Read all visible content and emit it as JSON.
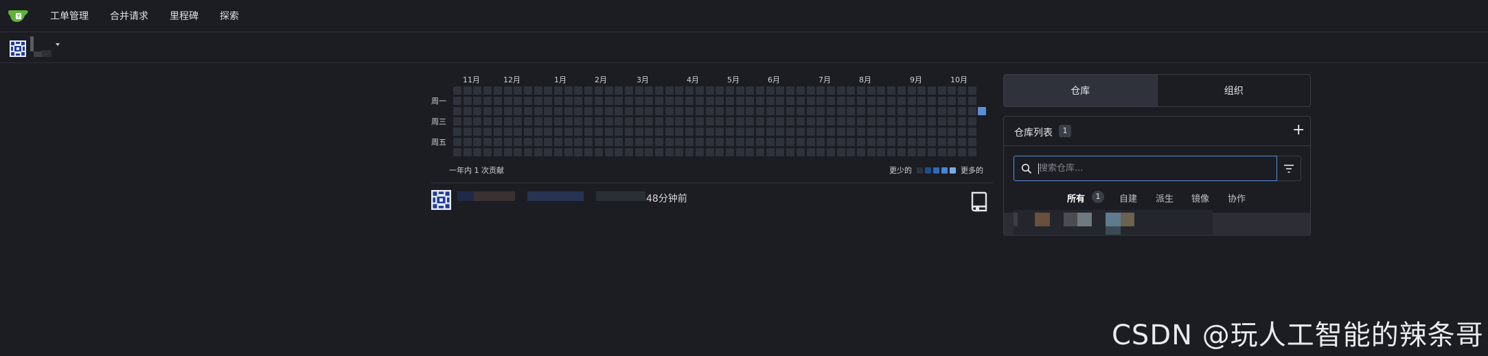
{
  "navbar": {
    "items": [
      "工单管理",
      "合并请求",
      "里程碑",
      "探索"
    ]
  },
  "heatmap": {
    "months": [
      "11月",
      "12月",
      "1月",
      "2月",
      "3月",
      "4月",
      "5月",
      "6月",
      "7月",
      "8月",
      "9月",
      "10月"
    ],
    "weekdays": [
      "周一",
      "周三",
      "周五"
    ],
    "summary": "一年内 1 次贡献",
    "legend_less": "更少的",
    "legend_more": "更多的",
    "legend_colors": [
      "#2e323b",
      "#1f4f8a",
      "#2f6ab8",
      "#4a86d2",
      "#7aa9e6"
    ],
    "contributions_total": 1
  },
  "feed": {
    "time": "48分钟前"
  },
  "right_panel": {
    "tabs": [
      "仓库",
      "组织"
    ],
    "active_tab": "仓库",
    "repo_list_title": "仓库列表",
    "repo_count": "1",
    "search_placeholder": "搜索仓库...",
    "filters": [
      "所有",
      "自建",
      "派生",
      "镜像",
      "协作"
    ],
    "active_filter": "所有",
    "filter_count": "1"
  },
  "watermark": "CSDN @玩人工智能的辣条哥",
  "icons": {
    "logo": "gitea-teacup-logo",
    "search": "search-icon",
    "filter": "filter-icon",
    "add": "plus-icon",
    "repo": "repo-icon"
  }
}
